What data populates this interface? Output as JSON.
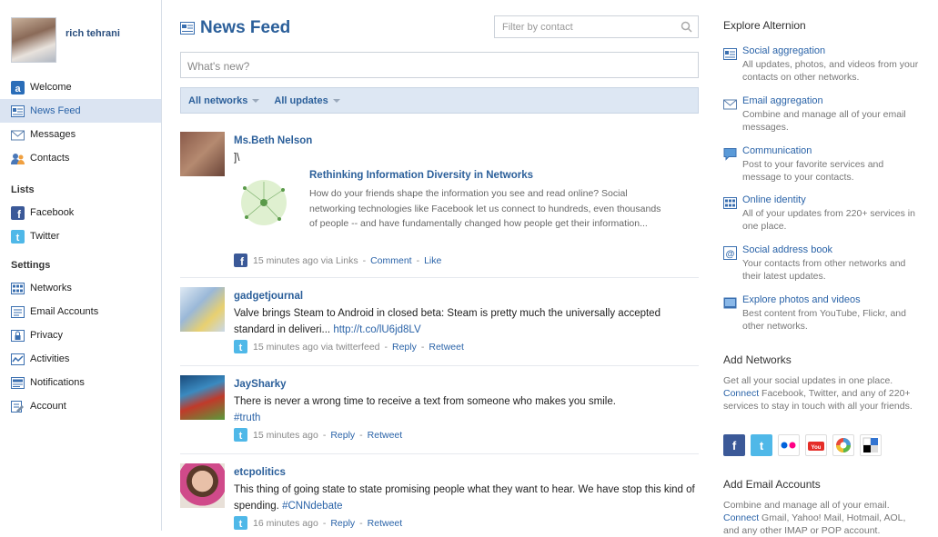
{
  "user": {
    "name": "rich tehrani"
  },
  "nav": {
    "items": [
      {
        "label": "Welcome"
      },
      {
        "label": "News Feed"
      },
      {
        "label": "Messages"
      },
      {
        "label": "Contacts"
      }
    ],
    "lists_heading": "Lists",
    "lists": [
      {
        "label": "Facebook"
      },
      {
        "label": "Twitter"
      }
    ],
    "settings_heading": "Settings",
    "settings": [
      {
        "label": "Networks"
      },
      {
        "label": "Email Accounts"
      },
      {
        "label": "Privacy"
      },
      {
        "label": "Activities"
      },
      {
        "label": "Notifications"
      },
      {
        "label": "Account"
      }
    ]
  },
  "main": {
    "title": "News Feed",
    "filter_placeholder": "Filter by contact",
    "whatsnew_placeholder": "What's new?",
    "dropdown_networks": "All networks",
    "dropdown_updates": "All updates"
  },
  "posts": [
    {
      "name": "Ms.Beth Nelson",
      "text": "]\\",
      "link_title": "Rethinking Information Diversity in Networks",
      "link_desc": "How do your friends shape the information you see and read online? Social networking technologies like Facebook let us connect to hundreds, even thousands of people -- and have fundamentally changed how people get their information...",
      "meta": "15 minutes ago via Links",
      "actions": [
        "Comment",
        "Like"
      ]
    },
    {
      "name": "gadgetjournal",
      "text": "Valve brings Steam to Android in closed beta: Steam is pretty much the universally accepted standard in deliveri...",
      "url": "http://t.co/lU6jd8LV",
      "meta": "15 minutes ago via twitterfeed",
      "actions": [
        "Reply",
        "Retweet"
      ]
    },
    {
      "name": "JaySharky",
      "text": "There is never a wrong time to receive a text from someone who makes you smile.",
      "hashtag": "#truth",
      "meta": "15 minutes ago",
      "actions": [
        "Reply",
        "Retweet"
      ]
    },
    {
      "name": "etcpolitics",
      "text": "This thing of going state to state promising people what they want to hear. We have stop this kind of spending.",
      "hashtag": "#CNNdebate",
      "meta": "16 minutes ago",
      "actions": [
        "Reply",
        "Retweet"
      ]
    }
  ],
  "explore": {
    "heading": "Explore Alternion",
    "items": [
      {
        "title": "Social aggregation",
        "desc": "All updates, photos, and videos from your contacts on other networks."
      },
      {
        "title": "Email aggregation",
        "desc": "Combine and manage all of your email messages."
      },
      {
        "title": "Communication",
        "desc": "Post to your favorite services and message to your contacts."
      },
      {
        "title": "Online identity",
        "desc": "All of your updates from 220+ services in one place."
      },
      {
        "title": "Social address book",
        "desc": "Your contacts from other networks and their latest updates."
      },
      {
        "title": "Explore photos and videos",
        "desc": "Best content from YouTube, Flickr, and other networks."
      }
    ]
  },
  "add_networks": {
    "heading": "Add Networks",
    "line1": "Get all your social updates in one place.",
    "connect": "Connect",
    "line2": " Facebook, Twitter, and any of 220+ services to stay in touch with all your friends."
  },
  "add_email": {
    "heading": "Add Email Accounts",
    "line1": "Combine and manage all of your email.",
    "connect": "Connect",
    "line2": " Gmail, Yahoo! Mail, Hotmail, AOL, and any other IMAP or POP account."
  },
  "colors": {
    "accent": "#2a63a8",
    "nav_active": "#dbe4f2",
    "filterbar": "#dde7f3"
  }
}
